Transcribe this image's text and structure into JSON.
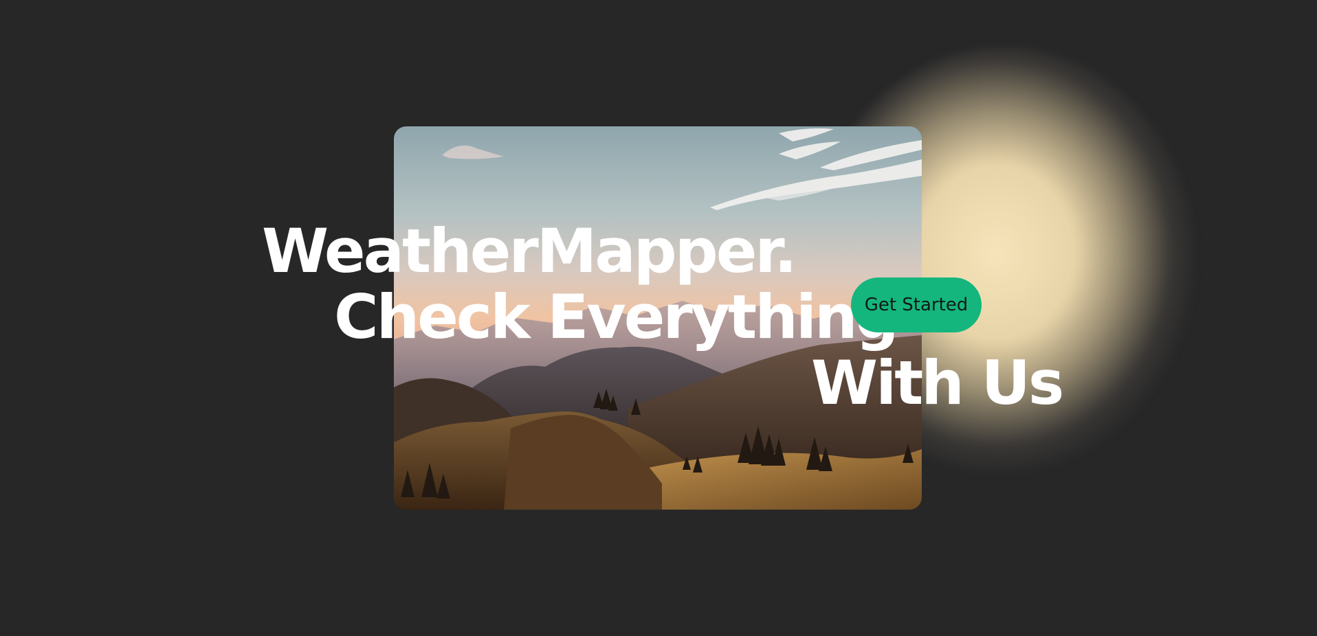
{
  "hero": {
    "headline": {
      "line1": "WeatherMapper.",
      "line2": "Check Everything",
      "line3": "With Us"
    },
    "cta_label": "Get Started",
    "image_subject": "mountain-landscape-at-sunset"
  },
  "colors": {
    "background": "#272728",
    "accent": "#14b67d",
    "glow": "#f5e3b8",
    "headline_text": "#ffffff",
    "cta_text": "#0f1a16"
  }
}
